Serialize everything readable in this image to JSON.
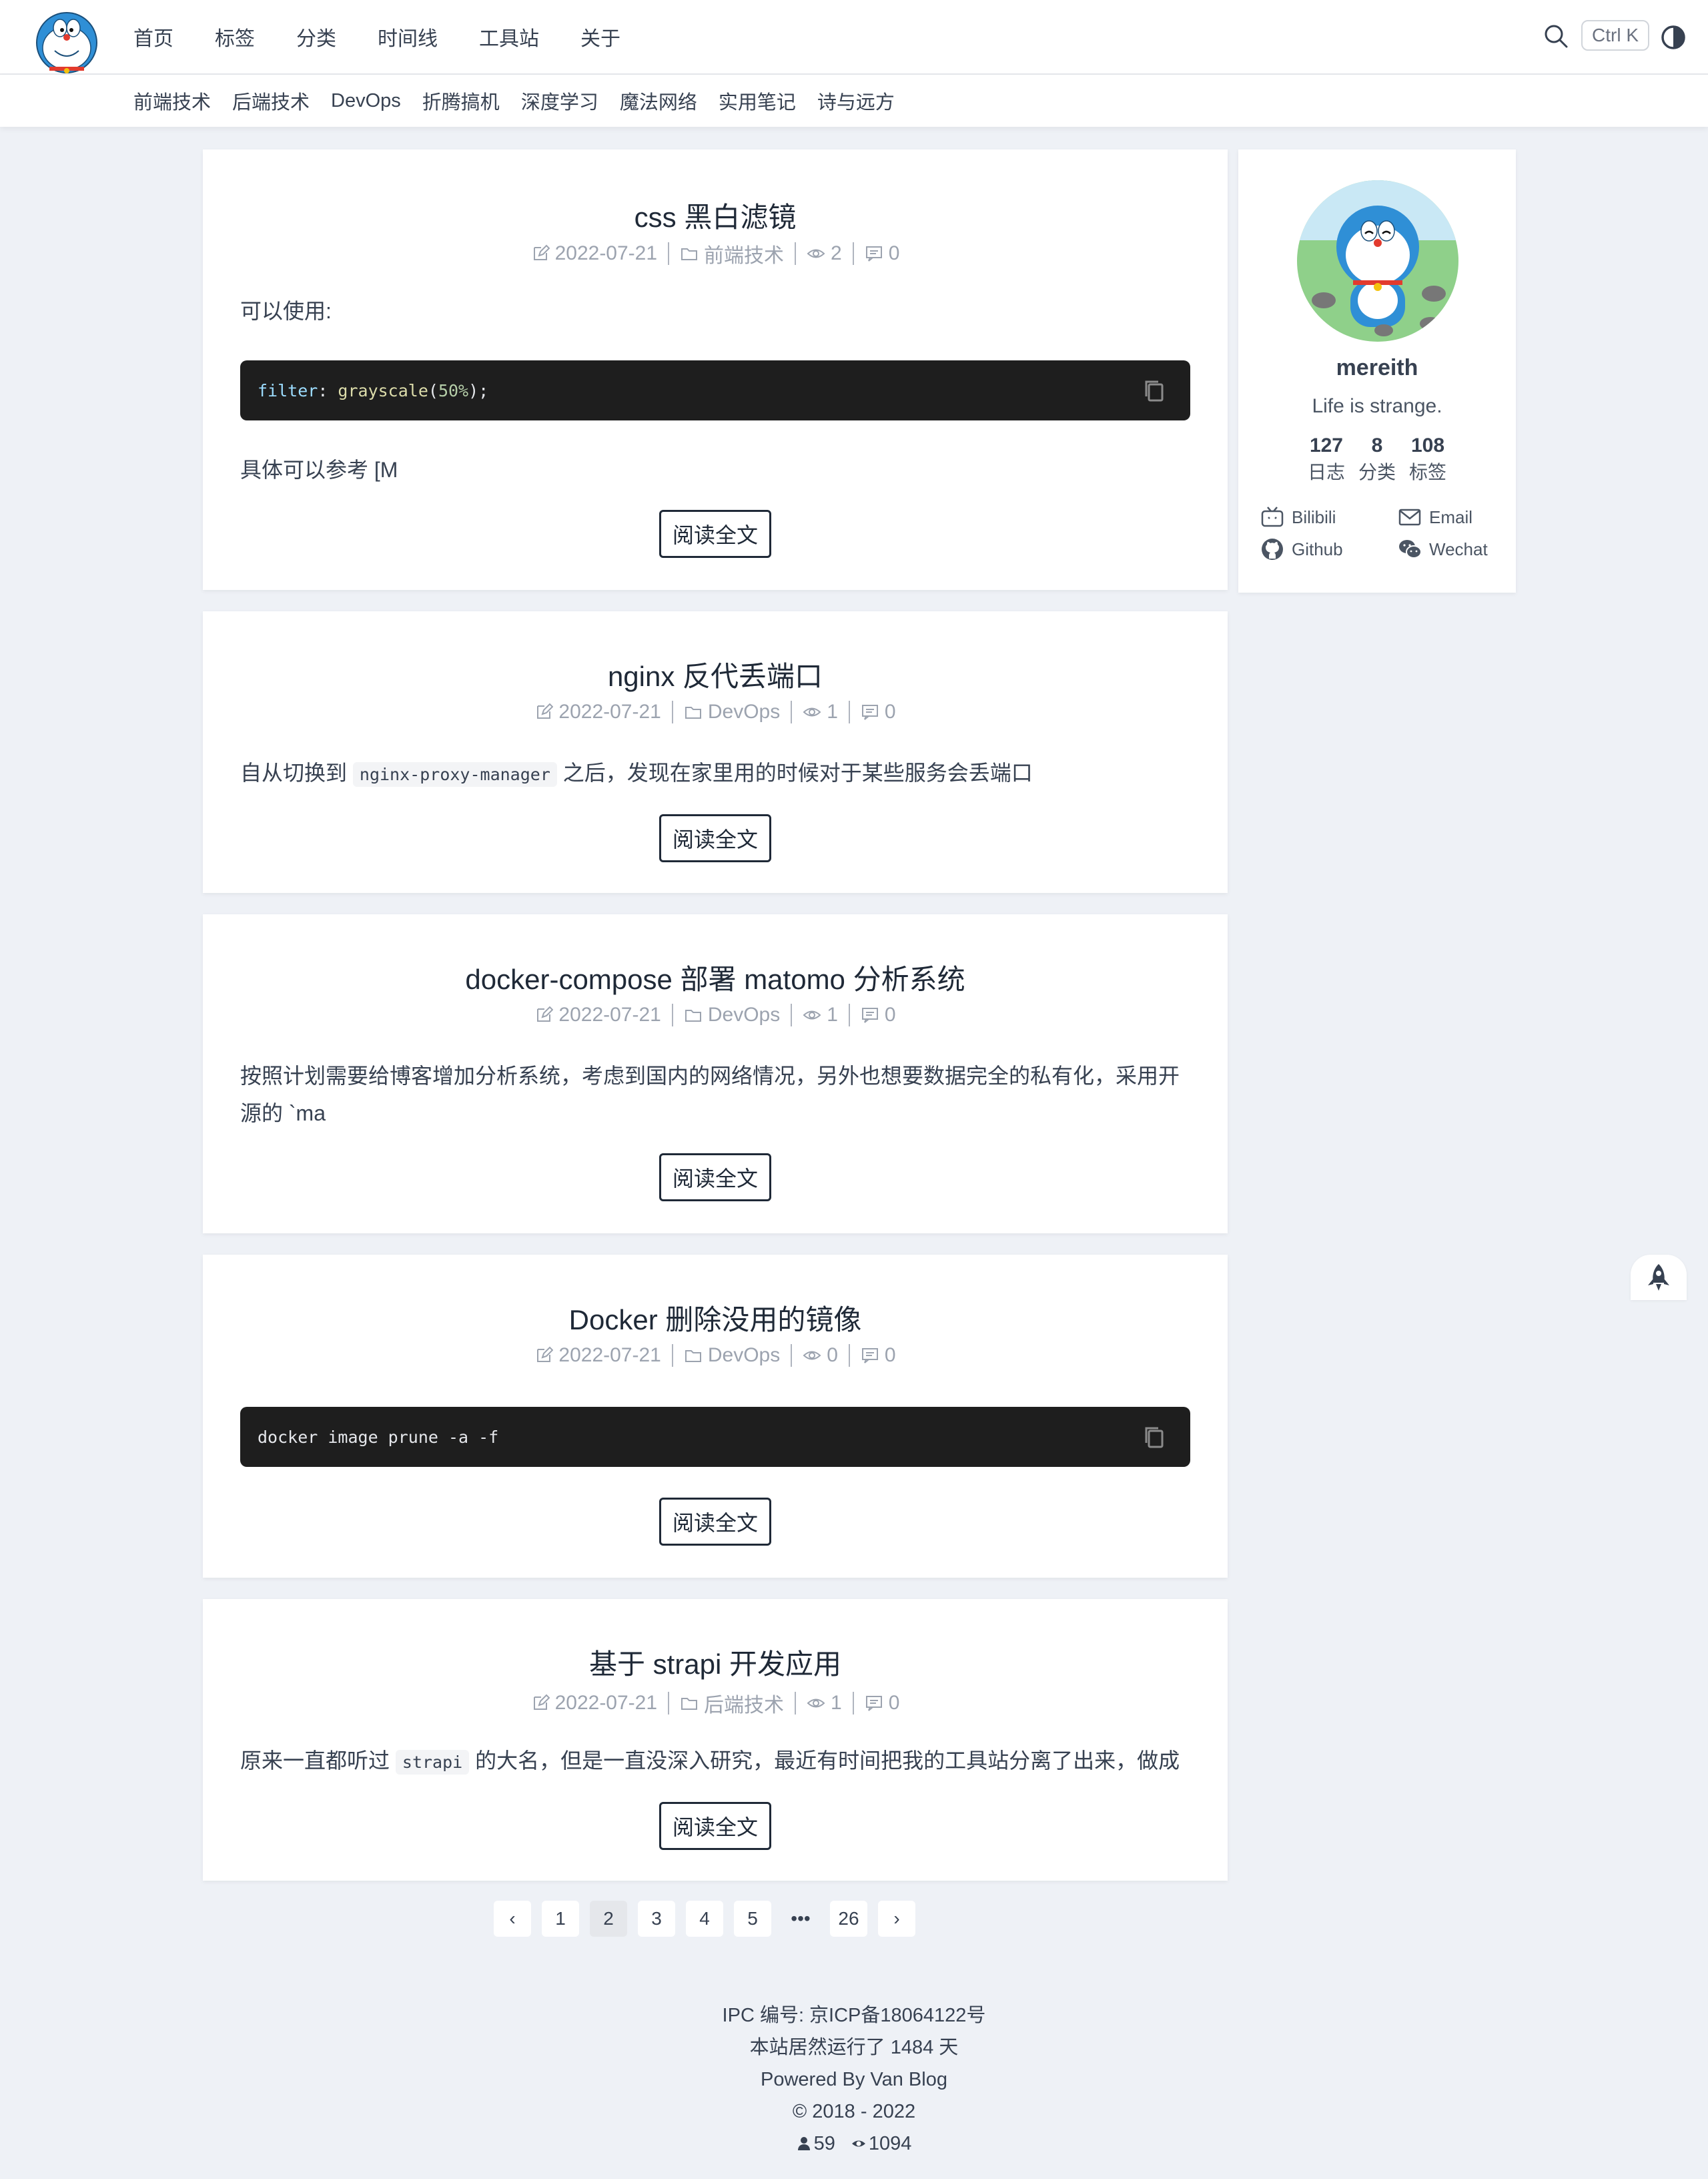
{
  "nav": {
    "main": [
      "首页",
      "标签",
      "分类",
      "时间线",
      "工具站",
      "关于"
    ],
    "sub": [
      "前端技术",
      "后端技术",
      "DevOps",
      "折腾搞机",
      "深度学习",
      "魔法网络",
      "实用笔记",
      "诗与远方"
    ],
    "shortcut": "Ctrl K"
  },
  "posts": [
    {
      "title": "css 黑白滤镜",
      "date": "2022-07-21",
      "category": "前端技术",
      "views": "2",
      "comments": "0",
      "intro": "可以使用:",
      "code_prop": "filter",
      "code_fn": "grayscale",
      "code_arg": "50%",
      "outro": "具体可以参考 [M",
      "read": "阅读全文"
    },
    {
      "title": "nginx 反代丢端口",
      "date": "2022-07-21",
      "category": "DevOps",
      "views": "1",
      "comments": "0",
      "text_before": "自从切换到",
      "code": "nginx-proxy-manager",
      "text_after": "之后，发现在家里用的时候对于某些服务会丢端口",
      "read": "阅读全文"
    },
    {
      "title": "docker-compose 部署 matomo 分析系统",
      "date": "2022-07-21",
      "category": "DevOps",
      "views": "1",
      "comments": "0",
      "line1": "按照计划需要给博客增加分析系统，考虑到国内的网络情况，另外也想要数据完全的私有化，采用开",
      "line2": "源的 `ma",
      "read": "阅读全文"
    },
    {
      "title": "Docker 删除没用的镜像",
      "date": "2022-07-21",
      "category": "DevOps",
      "views": "0",
      "comments": "0",
      "code": "docker image prune -a -f",
      "read": "阅读全文"
    },
    {
      "title": "基于 strapi 开发应用",
      "date": "2022-07-21",
      "category": "后端技术",
      "views": "1",
      "comments": "0",
      "text_before": "原来一直都听过",
      "code": "strapi",
      "text_after": "的大名，但是一直没深入研究，最近有时间把我的工具站分离了出来，做成",
      "read": "阅读全文"
    }
  ],
  "profile": {
    "name": "mereith",
    "motto": "Life is strange.",
    "stats": [
      {
        "num": "127",
        "label": "日志"
      },
      {
        "num": "8",
        "label": "分类"
      },
      {
        "num": "108",
        "label": "标签"
      }
    ],
    "links": {
      "bilibili": "Bilibili",
      "email": "Email",
      "github": "Github",
      "wechat": "Wechat"
    }
  },
  "pagination": {
    "prev": "‹",
    "pages": [
      "1",
      "2",
      "3",
      "4",
      "5"
    ],
    "dots": "•••",
    "last": "26",
    "next": "›",
    "current": "2"
  },
  "footer": {
    "icp": "IPC 编号: 京ICP备18064122号",
    "uptime": "本站居然运行了 1484 天",
    "powered": "Powered By Van Blog",
    "copyright": "© 2018 - 2022",
    "visitors": "59",
    "pageviews": "1094"
  },
  "icons": {
    "search": "search-icon",
    "theme": "theme-toggle-icon",
    "edit": "edit-icon",
    "folder": "folder-icon",
    "eye": "eye-icon",
    "comment": "comment-icon",
    "copy": "copy-icon",
    "rocket": "rocket-icon",
    "bilibili": "bilibili-icon",
    "email": "mail-icon",
    "github": "github-icon",
    "wechat": "wechat-icon",
    "user": "user-icon"
  }
}
